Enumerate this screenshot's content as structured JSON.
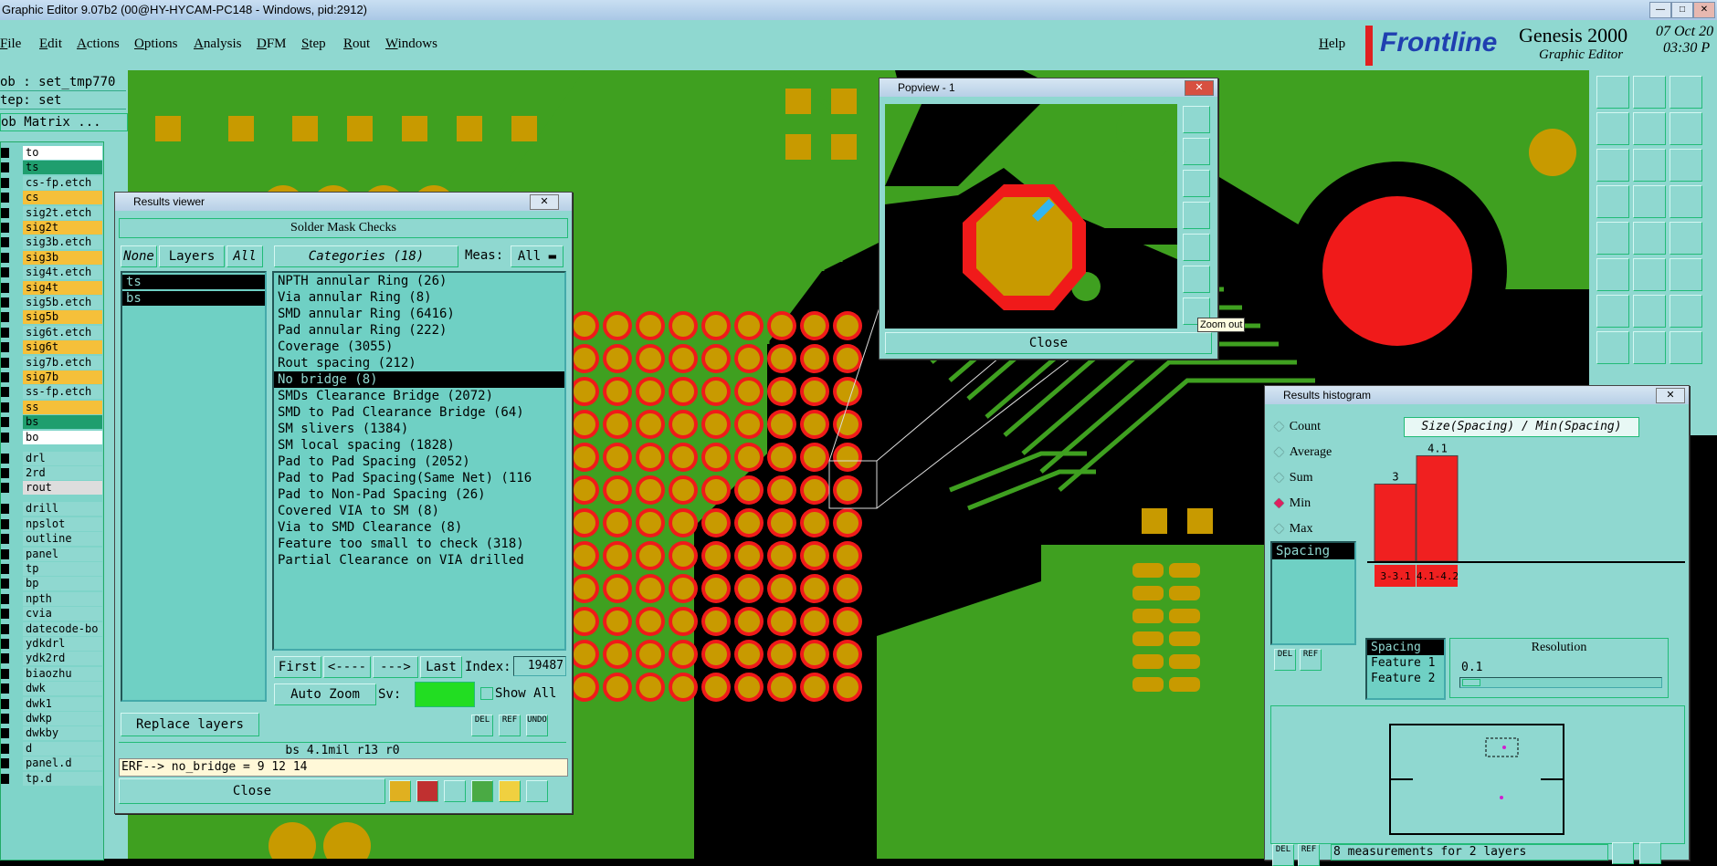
{
  "window": {
    "title": "Graphic Editor 9.07b2 (00@HY-HYCAM-PC148 - Windows, pid:2912)"
  },
  "menu": [
    "File",
    "Edit",
    "Actions",
    "Options",
    "Analysis",
    "DFM",
    "Step",
    "Rout",
    "Windows"
  ],
  "help": "Help",
  "brand": {
    "name": "Frontline",
    "product": "Genesis 2000",
    "subtitle": "Graphic Editor",
    "date": "07 Oct 20",
    "time": "03:30 P"
  },
  "left": {
    "job": "ob : set_tmp770",
    "step": "tep: set",
    "matrix_btn": "ob Matrix ...",
    "layers": [
      {
        "name": "to",
        "color": "#ffffff"
      },
      {
        "name": "ts",
        "color": "#1f9e6e"
      },
      {
        "name": "cs-fp.etch",
        "color": "#8fd8d0"
      },
      {
        "name": "cs",
        "color": "#f5c03a"
      },
      {
        "name": "sig2t.etch",
        "color": "#8fd8d0"
      },
      {
        "name": "sig2t",
        "color": "#f5c03a"
      },
      {
        "name": "sig3b.etch",
        "color": "#8fd8d0"
      },
      {
        "name": "sig3b",
        "color": "#f5c03a"
      },
      {
        "name": "sig4t.etch",
        "color": "#8fd8d0"
      },
      {
        "name": "sig4t",
        "color": "#f5c03a"
      },
      {
        "name": "sig5b.etch",
        "color": "#8fd8d0"
      },
      {
        "name": "sig5b",
        "color": "#f5c03a"
      },
      {
        "name": "sig6t.etch",
        "color": "#8fd8d0"
      },
      {
        "name": "sig6t",
        "color": "#f5c03a"
      },
      {
        "name": "sig7b.etch",
        "color": "#8fd8d0"
      },
      {
        "name": "sig7b",
        "color": "#f5c03a"
      },
      {
        "name": "ss-fp.etch",
        "color": "#8fd8d0"
      },
      {
        "name": "ss",
        "color": "#f5c03a"
      },
      {
        "name": "bs",
        "color": "#1f9e6e"
      },
      {
        "name": "bo",
        "color": "#ffffff"
      },
      {
        "name": "drl",
        "color": "#8fd8d0"
      },
      {
        "name": "2rd",
        "color": "#8fd8d0"
      },
      {
        "name": "rout",
        "color": "#dddddd"
      },
      {
        "name": "drill",
        "color": "#8fd8d0"
      },
      {
        "name": "npslot",
        "color": "#8fd8d0"
      },
      {
        "name": "outline",
        "color": "#8fd8d0"
      },
      {
        "name": "panel",
        "color": "#8fd8d0"
      },
      {
        "name": "tp",
        "color": "#8fd8d0"
      },
      {
        "name": "bp",
        "color": "#8fd8d0"
      },
      {
        "name": "npth",
        "color": "#8fd8d0"
      },
      {
        "name": "cvia",
        "color": "#8fd8d0"
      },
      {
        "name": "datecode-bo",
        "color": "#8fd8d0"
      },
      {
        "name": "ydkdrl",
        "color": "#8fd8d0"
      },
      {
        "name": "ydk2rd",
        "color": "#8fd8d0"
      },
      {
        "name": "biaozhu",
        "color": "#8fd8d0"
      },
      {
        "name": "dwk",
        "color": "#8fd8d0"
      },
      {
        "name": "dwk1",
        "color": "#8fd8d0"
      },
      {
        "name": "dwkp",
        "color": "#8fd8d0"
      },
      {
        "name": "dwkby",
        "color": "#8fd8d0"
      },
      {
        "name": "d",
        "color": "#8fd8d0"
      },
      {
        "name": "panel.d",
        "color": "#8fd8d0"
      },
      {
        "name": "tp.d",
        "color": "#8fd8d0"
      }
    ]
  },
  "results_viewer": {
    "title": "Results viewer",
    "header": "Solder Mask Checks",
    "none": "None",
    "layers": "Layers",
    "all": "All",
    "categories_btn": "Categories (18)",
    "meas_label": "Meas:",
    "meas_value": "All",
    "layer_items": [
      "ts",
      "bs"
    ],
    "categories": [
      "NPTH annular Ring (26)",
      "Via annular Ring (8)",
      "SMD annular Ring (6416)",
      "Pad annular Ring (222)",
      "Coverage (3055)",
      "Rout spacing (212)",
      "No bridge (8)",
      "SMDs Clearance Bridge (2072)",
      "SMD to Pad Clearance Bridge (64)",
      "SM slivers (1384)",
      "SM local spacing (1828)",
      "Pad to Pad Spacing (2052)",
      "Pad to Pad Spacing(Same Net) (116",
      "Pad to Non-Pad Spacing (26)",
      "Covered VIA to SM (8)",
      "Via to SMD Clearance (8)",
      "Feature too small to check (318)",
      "Partial Clearance on VIA drilled"
    ],
    "selected_category_index": 6,
    "first": "First",
    "prev": "<----",
    "next": "--->",
    "last": "Last",
    "index_label": "Index:",
    "index_value": "19487",
    "auto_zoom": "Auto Zoom",
    "sv_label": "Sv:",
    "show_all": "Show All",
    "replace_layers": "Replace layers",
    "del": "DEL",
    "ref": "REF",
    "undo": "UNDO",
    "status": "bs 4.1mil  r13  r0",
    "erf": "ERF--> no_bridge = 9 12 14",
    "close": "Close"
  },
  "popview": {
    "title": "Popview - 1",
    "close": "Close",
    "tooltip": "Zoom out"
  },
  "histogram": {
    "title": "Results histogram",
    "modes": [
      "Count",
      "Average",
      "Sum",
      "Min",
      "Max"
    ],
    "selected_mode": "Min",
    "list_item": "Spacing",
    "chart_title": "Size(Spacing) / Min(Spacing)",
    "fields": [
      "Spacing",
      "Feature 1",
      "Feature 2"
    ],
    "resolution_label": "Resolution",
    "resolution_value": "0.1",
    "del": "DEL",
    "ref": "REF",
    "status": "8 measurements for 2 layers"
  },
  "chart_data": {
    "type": "bar",
    "title": "Size(Spacing) / Min(Spacing)",
    "categories": [
      "3-3.1",
      "4.1-4.2"
    ],
    "values": [
      3,
      4.1
    ],
    "ylim": [
      0,
      4.4
    ],
    "bar_color": "#f02020"
  }
}
